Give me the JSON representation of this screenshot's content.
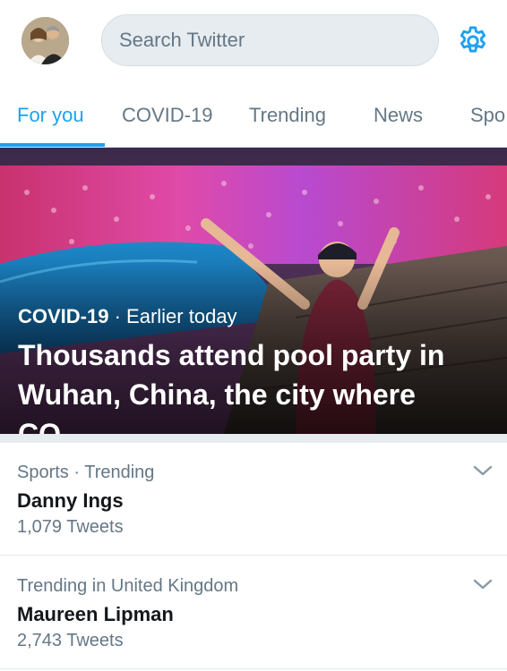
{
  "header": {
    "avatar_icon": "profile-avatar",
    "search": {
      "placeholder": "Search Twitter",
      "value": ""
    },
    "settings_icon": "gear-icon"
  },
  "tabs": [
    {
      "label": "For you",
      "active": true
    },
    {
      "label": "COVID-19",
      "active": false
    },
    {
      "label": "Trending",
      "active": false
    },
    {
      "label": "News",
      "active": false
    },
    {
      "label": "Spo",
      "active": false
    }
  ],
  "hero": {
    "category": "COVID-19",
    "separator": " · ",
    "time": "Earlier today",
    "headline": "Thousands attend pool party in Wuhan, China, the city where CO…"
  },
  "trends": [
    {
      "context": "Sports · Trending",
      "name": "Danny Ings",
      "count": "1,079 Tweets"
    },
    {
      "context": "Trending in United Kingdom",
      "name": "Maureen Lipman",
      "count": "2,743 Tweets"
    }
  ],
  "colors": {
    "accent": "#1da1f2",
    "secondary_text": "#657786",
    "primary_text": "#14171a",
    "divider": "#e6ecf0"
  }
}
